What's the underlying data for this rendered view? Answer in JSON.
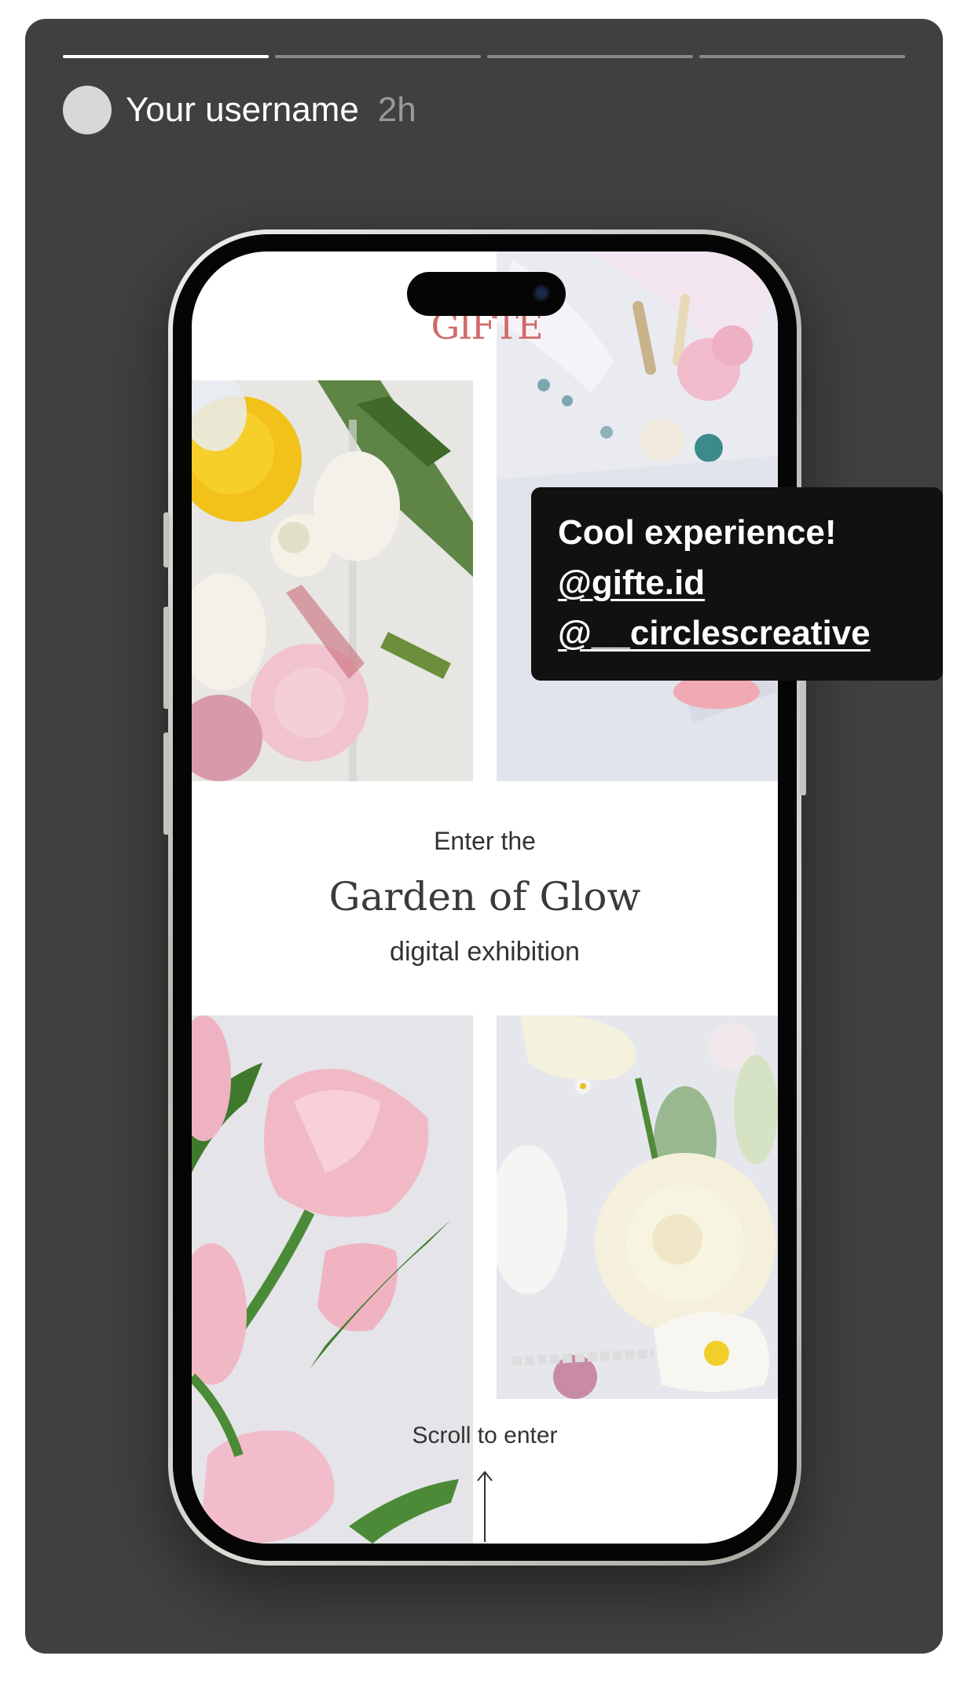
{
  "story": {
    "username": "Your username",
    "time": "2h",
    "progress_segments": [
      1,
      0,
      0,
      0
    ]
  },
  "screen": {
    "logo": "GIFTE",
    "intro_enter": "Enter the",
    "intro_title": "Garden of Glow",
    "intro_subtitle": "digital exhibition",
    "scroll_hint": "Scroll to enter"
  },
  "comment": {
    "text": "Cool experience!",
    "mentions": [
      "@gifte.id",
      "@__circlescreative"
    ]
  },
  "colors": {
    "story_bg": "#404040",
    "comment_bg": "#111111",
    "logo": "#d16a6a"
  },
  "icons": [
    "arrow-up-icon"
  ]
}
